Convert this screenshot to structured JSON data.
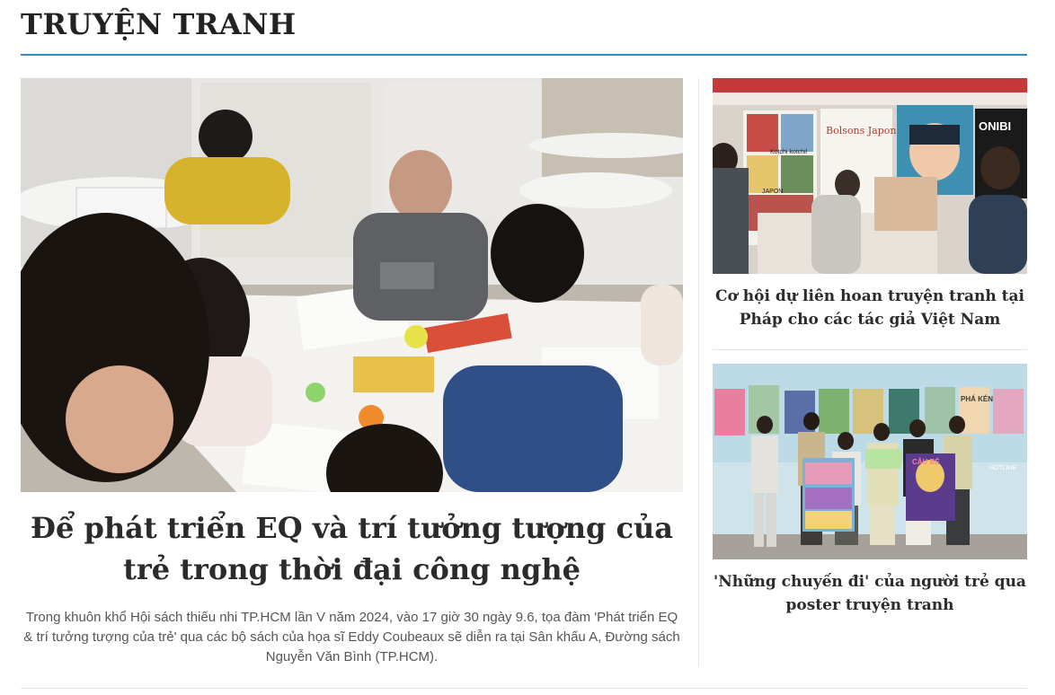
{
  "section": {
    "title": "TRUYỆN TRANH"
  },
  "main_story": {
    "title": "Để phát triển EQ và trí tưởng tượng của trẻ trong thời đại công nghệ",
    "description": "Trong khuôn khổ Hội sách thiếu nhi TP.HCM lần V năm 2024, vào 17 giờ 30 ngày 9.6, tọa đàm 'Phát triển EQ & trí tưởng tượng của trẻ' qua các bộ sách của họa sĩ Eddy Coubeaux sẽ diễn ra tại Sân khấu A, Đường sách Nguyễn Văn Bình (TP.HCM)."
  },
  "side_stories": [
    {
      "title": "Cơ hội dự liên hoan truyện tranh tại Pháp cho các tác giả Việt Nam",
      "image_sign_1": "Bolsons Japon",
      "image_sign_2": "ONIBI",
      "image_sign_3": "Kotchi kotchi!",
      "image_sign_4": "JAPON"
    },
    {
      "title": "'Những chuyến đi' của người trẻ qua poster truyện tranh",
      "image_sign_1": "HOTLINE",
      "image_sign_2": "CẬU BÉ",
      "image_sign_3": "PHÁ KÉN"
    }
  ],
  "colors": {
    "header_rule": "#2e8fb5",
    "title_text": "#2b2b2b",
    "desc_text": "#555555",
    "divider": "#e4e4e4"
  }
}
